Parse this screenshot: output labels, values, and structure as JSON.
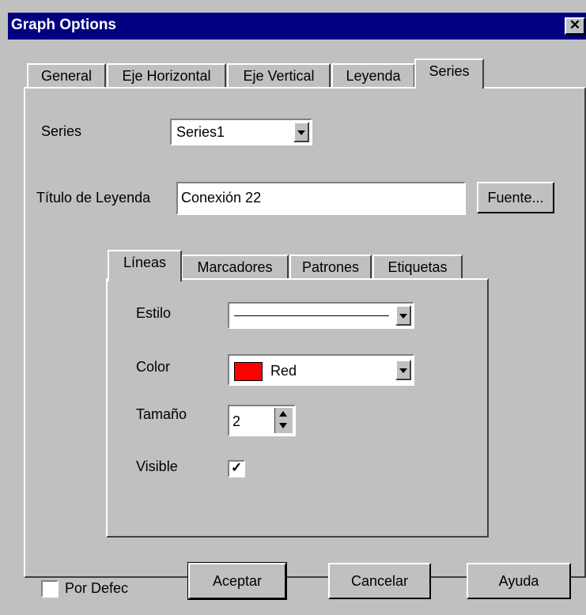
{
  "window": {
    "title": "Graph Options",
    "close_glyph": "✕"
  },
  "tabs": [
    "General",
    "Eje Horizontal",
    "Eje Vertical",
    "Leyenda",
    "Series"
  ],
  "active_tab": "Series",
  "series": {
    "label": "Series",
    "selected": "Series1"
  },
  "legend_title": {
    "label": "Título de Leyenda",
    "value": "Conexión 22",
    "font_button": "Fuente..."
  },
  "inner_tabs": [
    "Líneas",
    "Marcadores",
    "Patrones",
    "Etiquetas"
  ],
  "inner_active_tab": "Líneas",
  "lines": {
    "style_label": "Estilo",
    "color_label": "Color",
    "color_value": "Red",
    "color_swatch": "#ff0000",
    "size_label": "Tamaño",
    "size_value": "2",
    "visible_label": "Visible",
    "visible_checked": true,
    "check_glyph": "✓"
  },
  "footer": {
    "default_label": "Por Defec",
    "default_checked": false,
    "accept": "Aceptar",
    "cancel": "Cancelar",
    "help": "Ayuda"
  }
}
